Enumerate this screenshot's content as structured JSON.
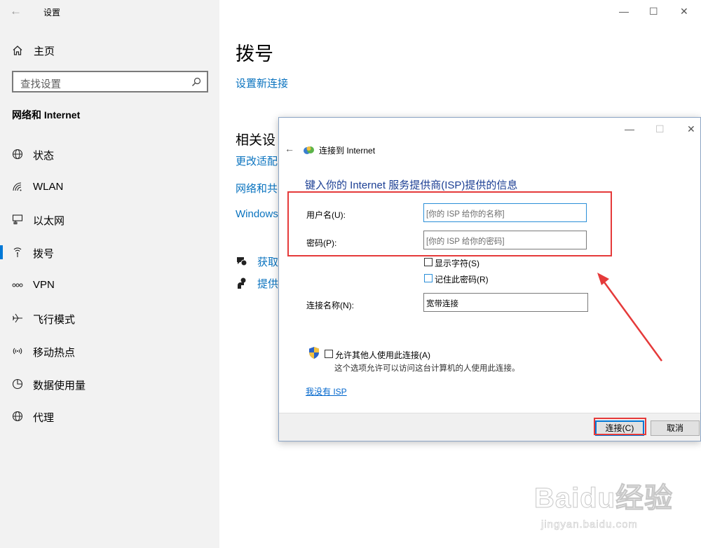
{
  "settings": {
    "title": "设置",
    "nav": {
      "home": "主页",
      "search_placeholder": "查找设置",
      "section": "网络和 Internet",
      "items": [
        {
          "label": "状态",
          "icon": "globe-status-icon"
        },
        {
          "label": "WLAN",
          "icon": "wifi-icon"
        },
        {
          "label": "以太网",
          "icon": "ethernet-icon"
        },
        {
          "label": "拨号",
          "icon": "dialup-icon",
          "selected": true
        },
        {
          "label": "VPN",
          "icon": "vpn-icon"
        },
        {
          "label": "飞行模式",
          "icon": "airplane-icon"
        },
        {
          "label": "移动热点",
          "icon": "hotspot-icon"
        },
        {
          "label": "数据使用量",
          "icon": "data-usage-icon"
        },
        {
          "label": "代理",
          "icon": "globe-proxy-icon"
        }
      ]
    },
    "main": {
      "page_title": "拨号",
      "new_connection_link": "设置新连接",
      "related_title": "相关设",
      "related_links": [
        "更改适配",
        "网络和共",
        "Windows"
      ],
      "help_links": [
        "获取",
        "提供"
      ]
    }
  },
  "dialog": {
    "title": "连接到 Internet",
    "heading": "键入你的 Internet 服务提供商(ISP)提供的信息",
    "username_label": "用户名(U):",
    "username_placeholder": "[你的 ISP 给你的名称]",
    "password_label": "密码(P):",
    "password_placeholder": "[你的 ISP 给你的密码]",
    "show_chars": "显示字符(S)",
    "remember_password": "记住此密码(R)",
    "connection_name_label": "连接名称(N):",
    "connection_name_value": "宽带连接",
    "allow_others": "允许其他人使用此连接(A)",
    "allow_others_note": "这个选项允许可以访问这台计算机的人使用此连接。",
    "no_isp_link": "我没有 ISP",
    "connect_button": "连接(C)",
    "cancel_button": "取消"
  },
  "watermark": {
    "brand": "Baidu经验",
    "url": "jingyan.baidu.com"
  },
  "colors": {
    "accent": "#0078d7",
    "link": "#0a73bf",
    "annotation": "#e53a3a",
    "dialog_heading": "#1c3f94"
  }
}
